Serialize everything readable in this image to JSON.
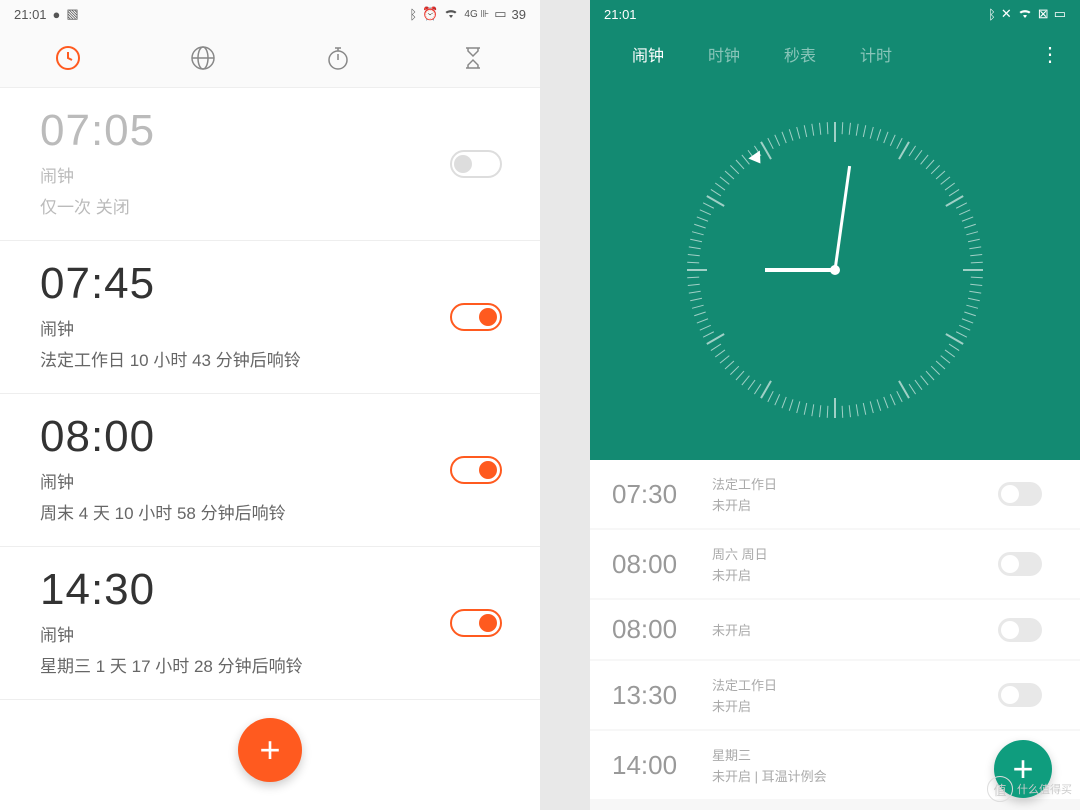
{
  "left": {
    "status": {
      "time": "21:01",
      "battery": "39"
    },
    "alarms": [
      {
        "time": "07:05",
        "label": "闹钟",
        "detail": "仅一次  关闭",
        "enabled": false
      },
      {
        "time": "07:45",
        "label": "闹钟",
        "detail": "法定工作日  10 小时 43 分钟后响铃",
        "enabled": true
      },
      {
        "time": "08:00",
        "label": "闹钟",
        "detail": "周末  4 天 10 小时 58 分钟后响铃",
        "enabled": true
      },
      {
        "time": "14:30",
        "label": "闹钟",
        "detail": "星期三  1 天 17 小时 28 分钟后响铃",
        "enabled": true
      }
    ]
  },
  "right": {
    "status": {
      "time": "21:01"
    },
    "tabs": [
      "闹钟",
      "时钟",
      "秒表",
      "计时"
    ],
    "activeTab": 0,
    "alarms": [
      {
        "time": "07:30",
        "line1": "法定工作日",
        "line2": "未开启"
      },
      {
        "time": "08:00",
        "line1": "周六 周日",
        "line2": "未开启"
      },
      {
        "time": "08:00",
        "line1": "未开启",
        "line2": ""
      },
      {
        "time": "13:30",
        "line1": "法定工作日",
        "line2": "未开启"
      },
      {
        "time": "14:00",
        "line1": "星期三",
        "line2": "未开启 | 耳温计例会"
      }
    ]
  },
  "watermark": "什么值得买"
}
